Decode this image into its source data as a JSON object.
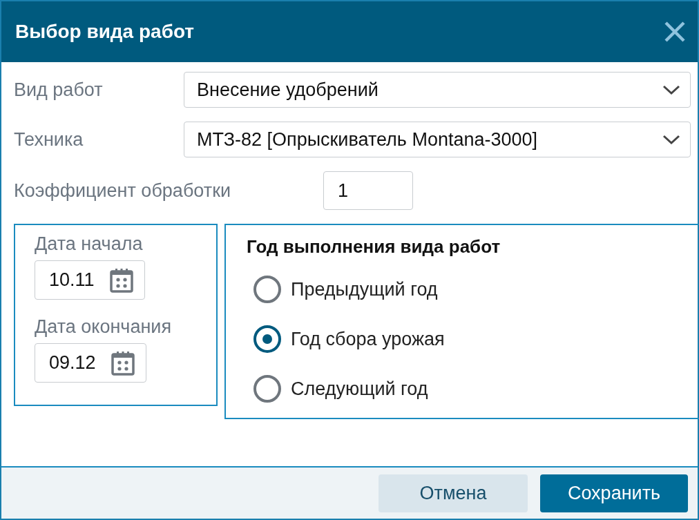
{
  "dialog": {
    "title": "Выбор вида работ"
  },
  "selects": [
    {
      "label": "Вид работ",
      "value": "Внесение  удобрений"
    },
    {
      "label": "Техника",
      "value": "МТЗ-82 [Опрыскиватель Montana-3000]"
    }
  ],
  "coefficient": {
    "label": "Коэффициент обработки",
    "value": "1"
  },
  "dates": [
    {
      "label": "Дата начала",
      "value": "10.11"
    },
    {
      "label": "Дата окончания",
      "value": "09.12"
    }
  ],
  "year_group": {
    "title": "Год выполнения вида работ",
    "options": [
      {
        "label": "Предыдущий год",
        "selected": false
      },
      {
        "label": "Год сбора урожая",
        "selected": true
      },
      {
        "label": "Следующий год",
        "selected": false
      }
    ]
  },
  "buttons": [
    {
      "label": "Отмена",
      "kind": "secondary"
    },
    {
      "label": "Сохранить",
      "kind": "primary"
    }
  ]
}
